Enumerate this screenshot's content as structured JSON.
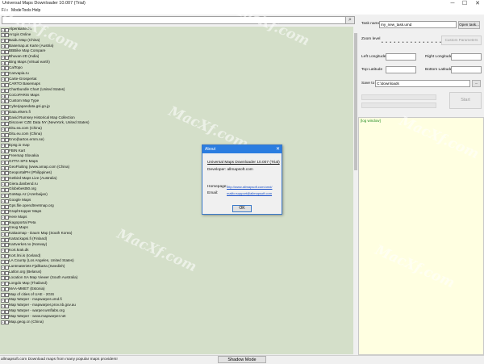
{
  "window": {
    "title": "Universal Maps Downloader 10.007 (Trial)",
    "min_glyph": "─",
    "max_glyph": "☐",
    "close_glyph": "✕"
  },
  "menu": [
    "File",
    "Mode",
    "Tools",
    "Help"
  ],
  "search": {
    "value": "",
    "button_icon": "search-icon",
    "button_glyph": "⌕"
  },
  "maps": [
    "Alpenkarte.eu",
    "Arcgis Online",
    "Baidu Map (China)",
    "Basemap.at Karte (Austria)",
    "BBBike Map Compare",
    "Bhuvan-2D (India)",
    "Bing Maps (Virtual earth)",
    "CalTopo",
    "Canvapia.ru",
    "Carte-Grospertat",
    "CARTO Basemaps",
    "Chartbundle Chart (United States)",
    "CoCoPARIS Maps",
    "Custom Map Type",
    "Cyberjapandata.gsi.go.jp",
    "Data.elsem.fi",
    "David Rumsey Historical Map Collection",
    "Discover CZE Data NY (NewYork, United States)",
    "Ditu.ea.com (China)",
    "Ditu.eu.com (China)",
    "Enro(barton.ernm.se)",
    "Epsg.io map",
    "FBIN Kart",
    "Freemap Slovakia",
    "GITTA SPS Maps",
    "GeoFluiting (www.amap.com (China)",
    "GeoportalPH (Philippines)",
    "Getbird Maps Live (Australia)",
    "Giera.danbend.ru",
    "Globebest50.org",
    "GoMap.Az (Azerbaijan)",
    "Google Maps",
    "Gps.file.opendtreetmap.org",
    "GraphHopper Maps",
    "Here Maps",
    "Ikagoportal Peta",
    "Izeug Maps",
    "Kakaomap - Daum Map (South Korea)",
    "Kartat.kapsi.fi (Finland)",
    "Kartverket.no (Norway)",
    "Kort.krak.dk",
    "Kort.lmi.is (Iceland)",
    "LA County (Los Angeles, United States)",
    "Lantmateriets Fjallkarta (Swedish)",
    "Latlon.org (Belarus)",
    "Location SA Map Viewer (South Australia)",
    "Longdo Map (Thailand)",
    "MAA-MMET (Estonia)",
    "Map of cities of UAE - 2GIS",
    "Map Warper - mapwarper.umd.fi",
    "Map Warper - mapwarper.prov.nb.gov.au",
    "Map Warper - warper.wmflabs.org",
    "Map Warper - www.mapwarper.net",
    "Map.geog.cn (China)"
  ],
  "right_panel": {
    "task_name_label": "Task name",
    "task_name_value": "my_new_task.umd",
    "open_task_button": "Open task...",
    "zoom_level_label": "Zoom level",
    "custom_parameters_button": "Custom Parameters",
    "left_longitude_label": "Left Longitude",
    "right_longitude_label": "Right Longitude",
    "top_latitude_label": "Top Latitude",
    "bottom_latitude_label": "Bottom Latitude",
    "left_longitude_value": "",
    "right_longitude_value": "",
    "top_latitude_value": "",
    "bottom_latitude_value": "",
    "save_to_label": "Save to",
    "save_to_value": "C:\\downloads",
    "browse_button": "...",
    "start_button": "Start",
    "log_title": "[log window]",
    "zoom_dots": "• • • • • • • • • • • • • • •"
  },
  "dialog": {
    "title": "About",
    "close_glyph": "✕",
    "app_line": "Universal Maps Downloader 10.007 (Trial)",
    "developer_line": "Developer: allmapsoft.com",
    "homepage_label": "Homepage:",
    "homepage_value": "http://www.allmapsoft.com/umd/",
    "email_label": "Email:",
    "email_value": "mailto:support@allmapsoft.com",
    "ok_button": "OK"
  },
  "status": {
    "text": "allmapsoft.com   Download maps from many popular maps providers!",
    "shadow_mode_button": "Shadow Mode"
  },
  "watermarks": [
    "MacXf.com",
    "MacXf.com",
    "MacXf.com",
    "MacXf.com",
    "MacXf.com",
    "MacXf.com"
  ],
  "colors": {
    "list_bg": "#d4dfc9",
    "log_bg": "#ffffe1",
    "dialog_title": "#2b7de0",
    "link": "#1a50c8"
  }
}
